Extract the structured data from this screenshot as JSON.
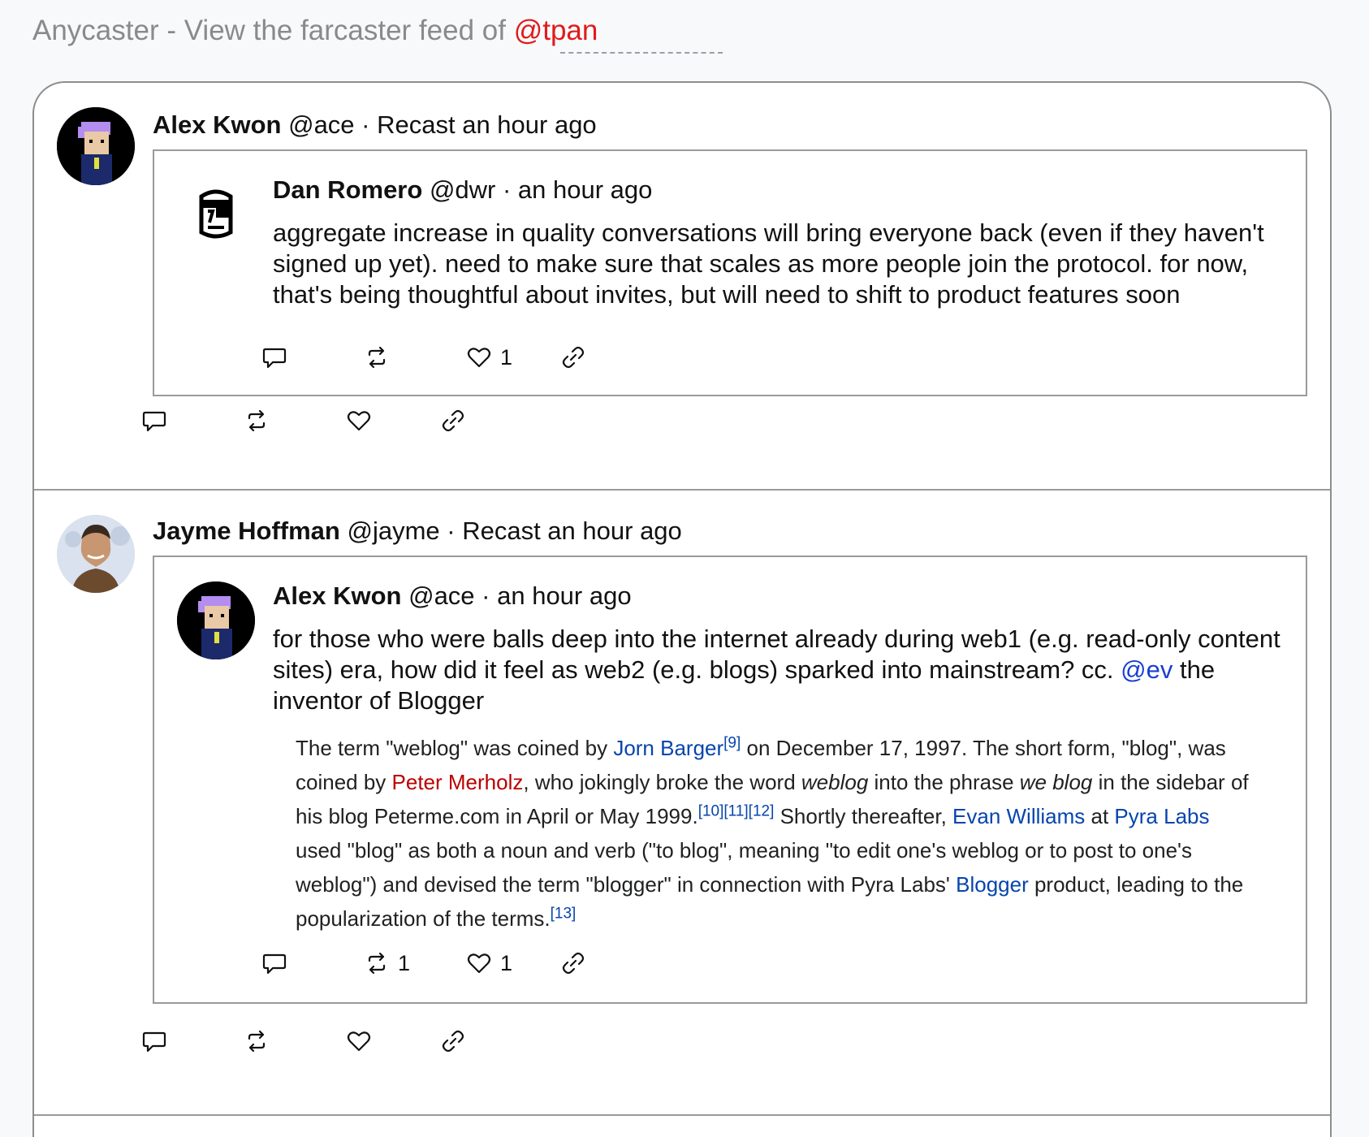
{
  "header": {
    "prefix": "Anycaster - View the farcaster feed of ",
    "handle": "@tpan"
  },
  "casts": [
    {
      "recaster": {
        "name": "Alex Kwon",
        "handle": "@ace",
        "meta": "· Recast an hour ago"
      },
      "quoted": {
        "author": {
          "name": "Dan Romero",
          "handle": "@dwr",
          "meta": "· an hour ago"
        },
        "text": "aggregate increase in quality conversations will bring everyone back (even if they haven't signed up yet). need to make sure that scales as more people join the protocol. for now, that's being thoughtful about invites, but will need to shift to product features soon",
        "reactions": {
          "replies": "",
          "recasts": "",
          "likes": "1"
        }
      },
      "reactions": {
        "replies": "",
        "recasts": "",
        "likes": ""
      }
    },
    {
      "recaster": {
        "name": "Jayme Hoffman",
        "handle": "@jayme",
        "meta": "· Recast an hour ago"
      },
      "quoted": {
        "author": {
          "name": "Alex Kwon",
          "handle": "@ace",
          "meta": "· an hour ago"
        },
        "text_before": "for those who were balls deep into the internet already during web1 (e.g. read-only content sites) era, how did it feel as web2 (e.g. blogs) sparked into mainstream? cc.",
        "mention": "@ev",
        "text_after": " the inventor of Blogger",
        "wiki": {
          "p1": "The term \"weblog\" was coined by ",
          "jorn": "Jorn Barger",
          "ref9": "[9]",
          "p2": " on December 17, 1997. The short form, \"blog\", was coined by ",
          "peter": "Peter Merholz",
          "p3": ", who jokingly broke the word ",
          "weblog": "weblog",
          "p4": " into the phrase ",
          "weblog2": "we blog",
          "p5": " in the sidebar of his blog Peterme.com in April or May 1999.",
          "ref10": "[10][11][12]",
          "p6": " Shortly thereafter, ",
          "evan": "Evan Williams",
          "p7": " at ",
          "pyra": "Pyra Labs",
          "p8": " used \"blog\" as both a noun and verb (\"to blog\", meaning \"to edit one's weblog or to post to one's weblog\") and devised the term \"blogger\" in connection with Pyra Labs' ",
          "blogger": "Blogger",
          "p9": " product, leading to the popularization of the terms.",
          "ref13": "[13]"
        },
        "reactions": {
          "replies": "",
          "recasts": "1",
          "likes": "1"
        }
      },
      "reactions": {
        "replies": "",
        "recasts": "",
        "likes": ""
      }
    }
  ],
  "icons": {
    "reply": "comment-icon",
    "recast": "recast-icon",
    "like": "heart-icon",
    "link": "link-icon"
  },
  "colors": {
    "mention_red": "#e11a1a",
    "link_blue": "#1a3fd1",
    "wiki_link": "#0645ad",
    "wiki_redlink": "#ba0000"
  }
}
